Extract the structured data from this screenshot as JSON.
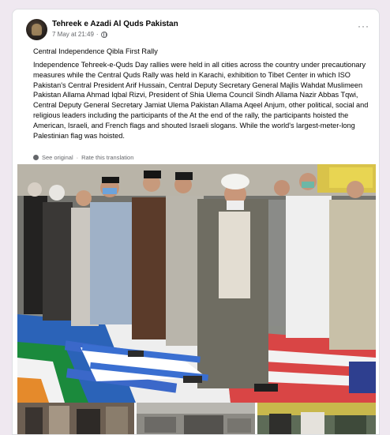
{
  "post": {
    "author": "Tehreek e Azadi Al Quds Pakistan",
    "timestamp": "7 May at 21:49",
    "separator": "·",
    "privacy_icon": "globe-icon",
    "more_icon": "more-options-icon",
    "title": "Central Independence Qibla First Rally",
    "body": "Independence Tehreek-e-Quds Day rallies were held in all cities across the country under precautionary measures while the Central Quds Rally was held in Karachi, exhibition to Tibet Center in which ISO Pakistan's Central President Arif Hussain, Central Deputy Secretary General Majlis Wahdat Muslimeen Pakistan Allama Ahmad Iqbal Rizvi, President of Shia Ulema Council Sindh Allama Nazir Abbas Tqwi, Central Deputy General Secretary Jamiat Ulema Pakistan Allama Aqeel Anjum, other political, social and religious leaders including the participants of the At the end of the rally, the participants hoisted the American, Israeli, and French flags and shouted Israeli slogans. While the world's largest-meter-long Palestinian flag was hoisted.",
    "see_original": "See original",
    "dot": "·",
    "rate_translation": "Rate this translation"
  },
  "media": {
    "main_photo": "rally-photo",
    "thumbnails": [
      "rally-thumb-1",
      "rally-thumb-2",
      "rally-thumb-3"
    ]
  },
  "colors": {
    "page_bg": "#efe8f0",
    "card_bg": "#ffffff",
    "text_primary": "#050505",
    "text_secondary": "#65676b"
  }
}
